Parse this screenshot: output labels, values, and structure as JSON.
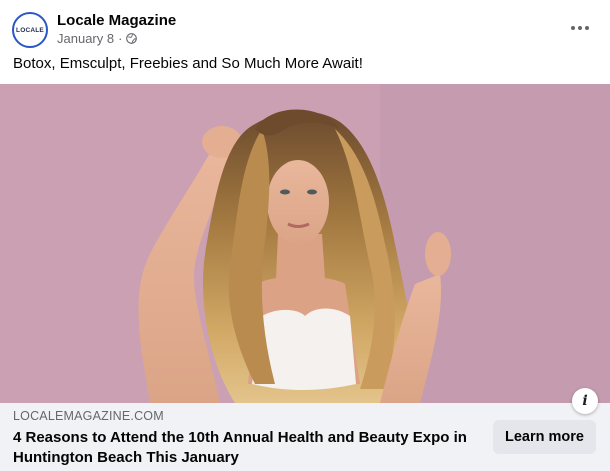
{
  "page": {
    "avatar_text": "LOCALE",
    "name": "Locale Magazine",
    "date": "January 8",
    "separator": "·",
    "privacy_icon": "globe-icon"
  },
  "post": {
    "caption": "Botox, Emsculpt, Freebies and So Much More Await!",
    "more_icon": "more-options-icon"
  },
  "link": {
    "domain": "LOCALEMAGAZINE.COM",
    "headline": "4 Reasons to Attend the 10th Annual Health and Beauty Expo in Huntington Beach This January",
    "cta_label": "Learn more",
    "info_glyph": "i"
  },
  "colors": {
    "brand_blue": "#2a56c6",
    "link_bar_bg": "#f0f2f5",
    "button_bg": "#e4e6eb",
    "muted_text": "#65676b",
    "photo_background": "#cfa4b5"
  }
}
